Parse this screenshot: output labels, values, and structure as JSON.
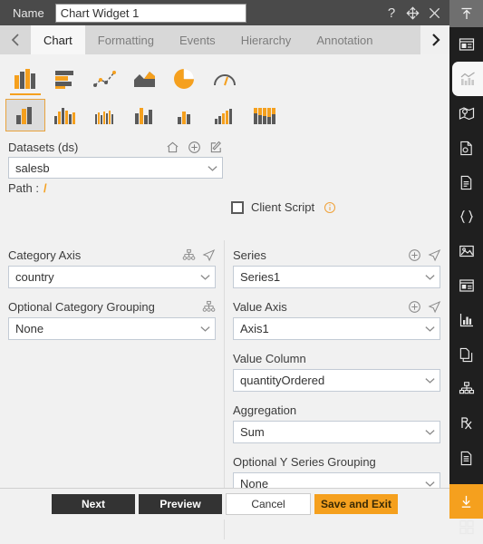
{
  "titlebar": {
    "name_label": "Name",
    "widget_name": "Chart Widget 1",
    "name_placeholder": "Chart Widget 1",
    "help_icon": "question-mark-icon",
    "move_icon": "move-icon",
    "close_icon": "close-icon"
  },
  "tabs": {
    "prev_arrow": "chevron-left-icon",
    "next_arrow": "chevron-right-icon",
    "items": [
      {
        "label": "Chart",
        "active": true
      },
      {
        "label": "Formatting",
        "active": false
      },
      {
        "label": "Events",
        "active": false
      },
      {
        "label": "Hierarchy",
        "active": false
      },
      {
        "label": "Annotation",
        "active": false
      }
    ]
  },
  "chart_types": {
    "row1": [
      {
        "name": "column-chart-icon",
        "selected": true
      },
      {
        "name": "bar-chart-icon",
        "selected": false
      },
      {
        "name": "line-scatter-chart-icon",
        "selected": false
      },
      {
        "name": "area-chart-icon",
        "selected": false
      },
      {
        "name": "pie-chart-icon",
        "selected": false
      },
      {
        "name": "gauge-chart-icon",
        "selected": false
      }
    ],
    "row2": [
      {
        "name": "clustered-column-icon",
        "selected": true
      },
      {
        "name": "multi-series-column-icon",
        "selected": false
      },
      {
        "name": "thin-column-icon",
        "selected": false
      },
      {
        "name": "grouped-column-icon",
        "selected": false
      },
      {
        "name": "small-column-icon",
        "selected": false
      },
      {
        "name": "stepped-column-icon",
        "selected": false
      },
      {
        "name": "stacked-column-icon",
        "selected": false
      }
    ]
  },
  "datasets": {
    "label": "Datasets (ds)",
    "value": "salesb",
    "path_label": "Path :",
    "path_value": "/",
    "home_icon": "home-icon",
    "add_icon": "plus-circle-icon",
    "edit_icon": "edit-square-icon"
  },
  "client_script": {
    "label": "Client Script",
    "checked": false,
    "info_icon": "info-circle-icon"
  },
  "left_column": {
    "fields": [
      {
        "label": "Category Axis",
        "value": "country",
        "icons": [
          "hierarchy-icon",
          "send-icon"
        ]
      },
      {
        "label": "Optional Category Grouping",
        "value": "None",
        "icons": [
          "hierarchy-icon"
        ]
      }
    ]
  },
  "right_column": {
    "fields": [
      {
        "label": "Series",
        "value": "Series1",
        "icons": [
          "plus-circle-icon",
          "send-icon"
        ]
      },
      {
        "label": "Value Axis",
        "value": "Axis1",
        "icons": [
          "plus-circle-icon",
          "send-icon"
        ]
      },
      {
        "label": "Value Column",
        "value": "quantityOrdered",
        "icons": []
      },
      {
        "label": "Aggregation",
        "value": "Sum",
        "icons": []
      },
      {
        "label": "Optional Y Series Grouping",
        "value": "None",
        "icons": []
      }
    ]
  },
  "footer": {
    "next": "Next",
    "preview": "Preview",
    "cancel": "Cancel",
    "save_and_exit": "Save and Exit"
  },
  "rail": {
    "top_icon": "collapse-up-icon",
    "bottom_icon": "download-icon",
    "items": [
      {
        "name": "widget-panel-icon",
        "active": false
      },
      {
        "name": "chart-widget-icon",
        "active": true
      },
      {
        "name": "map-widget-icon",
        "active": false
      },
      {
        "name": "report-widget-icon",
        "active": false
      },
      {
        "name": "document-widget-icon",
        "active": false
      },
      {
        "name": "code-braces-icon",
        "active": false
      },
      {
        "name": "image-widget-icon",
        "active": false
      },
      {
        "name": "form-widget-icon",
        "active": false
      },
      {
        "name": "kpi-widget-icon",
        "active": false
      },
      {
        "name": "page-copy-icon",
        "active": false
      },
      {
        "name": "hierarchy-widget-icon",
        "active": false
      },
      {
        "name": "prescription-icon",
        "active": false
      },
      {
        "name": "list-document-icon",
        "active": false
      },
      {
        "name": "layers-icon",
        "active": false
      },
      {
        "name": "grid-widget-icon",
        "active": false
      }
    ]
  },
  "colors": {
    "accent": "#f5a01e",
    "titlebar": "#4a4a4a",
    "rail": "#1f1f1f",
    "panel": "#f1f1f1"
  }
}
